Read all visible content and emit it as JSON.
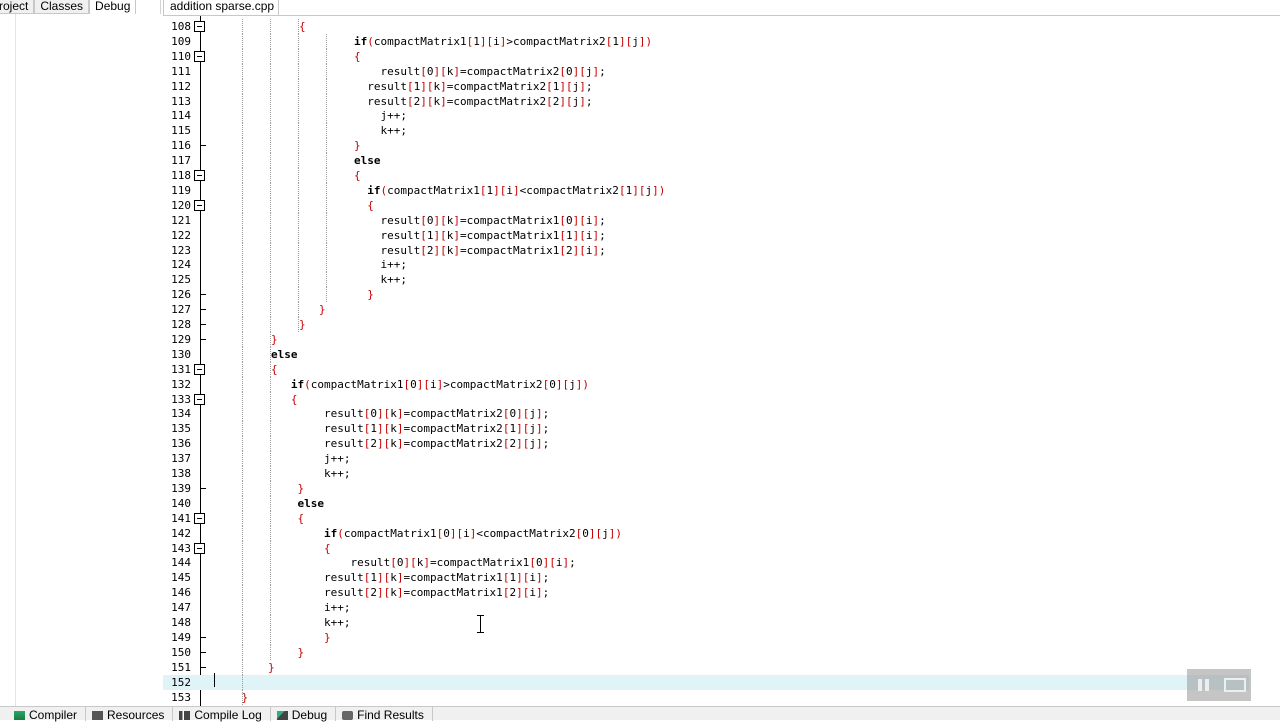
{
  "left_panel": {
    "tabs": [
      "roject",
      "Classes",
      "Debug"
    ],
    "active_tab": "Debug"
  },
  "editor": {
    "file_tab": "addition sparse.cpp",
    "current_line": 152,
    "lines": [
      {
        "n": 108,
        "indent": 2,
        "text": "{",
        "fold": true
      },
      {
        "n": 109,
        "indent": 3,
        "text": "if(compactMatrix1[1][i]>compactMatrix2[1][j])"
      },
      {
        "n": 110,
        "indent": 3,
        "text": "{",
        "fold": true
      },
      {
        "n": 111,
        "indent": 3,
        "text": "    result[0][k]=compactMatrix2[0][j];"
      },
      {
        "n": 112,
        "indent": 3,
        "text": "  result[1][k]=compactMatrix2[1][j];"
      },
      {
        "n": 113,
        "indent": 3,
        "text": "  result[2][k]=compactMatrix2[2][j];"
      },
      {
        "n": 114,
        "indent": 3,
        "text": "    j++;"
      },
      {
        "n": 115,
        "indent": 3,
        "text": "    k++;"
      },
      {
        "n": 116,
        "indent": 3,
        "text": "}",
        "tick": true
      },
      {
        "n": 117,
        "indent": 3,
        "text": "else"
      },
      {
        "n": 118,
        "indent": 3,
        "text": "{",
        "fold": true
      },
      {
        "n": 119,
        "indent": 3,
        "text": "  if(compactMatrix1[1][i]<compactMatrix2[1][j])"
      },
      {
        "n": 120,
        "indent": 3,
        "text": "  {",
        "fold": true
      },
      {
        "n": 121,
        "indent": 3,
        "text": "    result[0][k]=compactMatrix1[0][i];"
      },
      {
        "n": 122,
        "indent": 3,
        "text": "    result[1][k]=compactMatrix1[1][i];"
      },
      {
        "n": 123,
        "indent": 3,
        "text": "    result[2][k]=compactMatrix1[2][i];"
      },
      {
        "n": 124,
        "indent": 3,
        "text": "    i++;"
      },
      {
        "n": 125,
        "indent": 3,
        "text": "    k++;"
      },
      {
        "n": 126,
        "indent": 3,
        "text": "  }",
        "tick": true
      },
      {
        "n": 127,
        "indent": 2,
        "text": "   }",
        "tick": true
      },
      {
        "n": 128,
        "indent": 2,
        "text": "}",
        "tick": true
      },
      {
        "n": 129,
        "indent": 1,
        "text": "}",
        "tick": true
      },
      {
        "n": 130,
        "indent": 1,
        "text": "else"
      },
      {
        "n": 131,
        "indent": 1,
        "text": "{",
        "fold": true
      },
      {
        "n": 132,
        "indent": 1,
        "text": "   if(compactMatrix1[0][i]>compactMatrix2[0][j])"
      },
      {
        "n": 133,
        "indent": 1,
        "text": "   {",
        "fold": true
      },
      {
        "n": 134,
        "indent": 1,
        "text": "        result[0][k]=compactMatrix2[0][j];"
      },
      {
        "n": 135,
        "indent": 1,
        "text": "        result[1][k]=compactMatrix2[1][j];"
      },
      {
        "n": 136,
        "indent": 1,
        "text": "        result[2][k]=compactMatrix2[2][j];"
      },
      {
        "n": 137,
        "indent": 1,
        "text": "        j++;"
      },
      {
        "n": 138,
        "indent": 1,
        "text": "        k++;"
      },
      {
        "n": 139,
        "indent": 1,
        "text": "    }",
        "tick": true
      },
      {
        "n": 140,
        "indent": 1,
        "text": "    else"
      },
      {
        "n": 141,
        "indent": 1,
        "text": "    {",
        "fold": true
      },
      {
        "n": 142,
        "indent": 1,
        "text": "        if(compactMatrix1[0][i]<compactMatrix2[0][j])"
      },
      {
        "n": 143,
        "indent": 1,
        "text": "        {",
        "fold": true
      },
      {
        "n": 144,
        "indent": 1,
        "text": "            result[0][k]=compactMatrix1[0][i];"
      },
      {
        "n": 145,
        "indent": 1,
        "text": "        result[1][k]=compactMatrix1[1][i];"
      },
      {
        "n": 146,
        "indent": 1,
        "text": "        result[2][k]=compactMatrix1[2][i];"
      },
      {
        "n": 147,
        "indent": 1,
        "text": "        i++;"
      },
      {
        "n": 148,
        "indent": 1,
        "text": "        k++;"
      },
      {
        "n": 149,
        "indent": 1,
        "text": "        }",
        "tick": true
      },
      {
        "n": 150,
        "indent": 1,
        "text": "    }",
        "tick": true
      },
      {
        "n": 151,
        "indent": 0,
        "text": "        }",
        "tick": true
      },
      {
        "n": 152,
        "indent": 0,
        "text": ""
      },
      {
        "n": 153,
        "indent": 0,
        "text": "    }"
      }
    ]
  },
  "bottom_tabs": [
    {
      "label": "Compiler",
      "icon": "compiler-icon"
    },
    {
      "label": "Resources",
      "icon": "resources-icon"
    },
    {
      "label": "Compile Log",
      "icon": "compile-log-icon"
    },
    {
      "label": "Debug",
      "icon": "debug-icon"
    },
    {
      "label": "Find Results",
      "icon": "find-results-icon"
    }
  ],
  "colors": {
    "bracket": "#c40000",
    "current_line": "#e0f4f8",
    "keyword": "#000000"
  }
}
